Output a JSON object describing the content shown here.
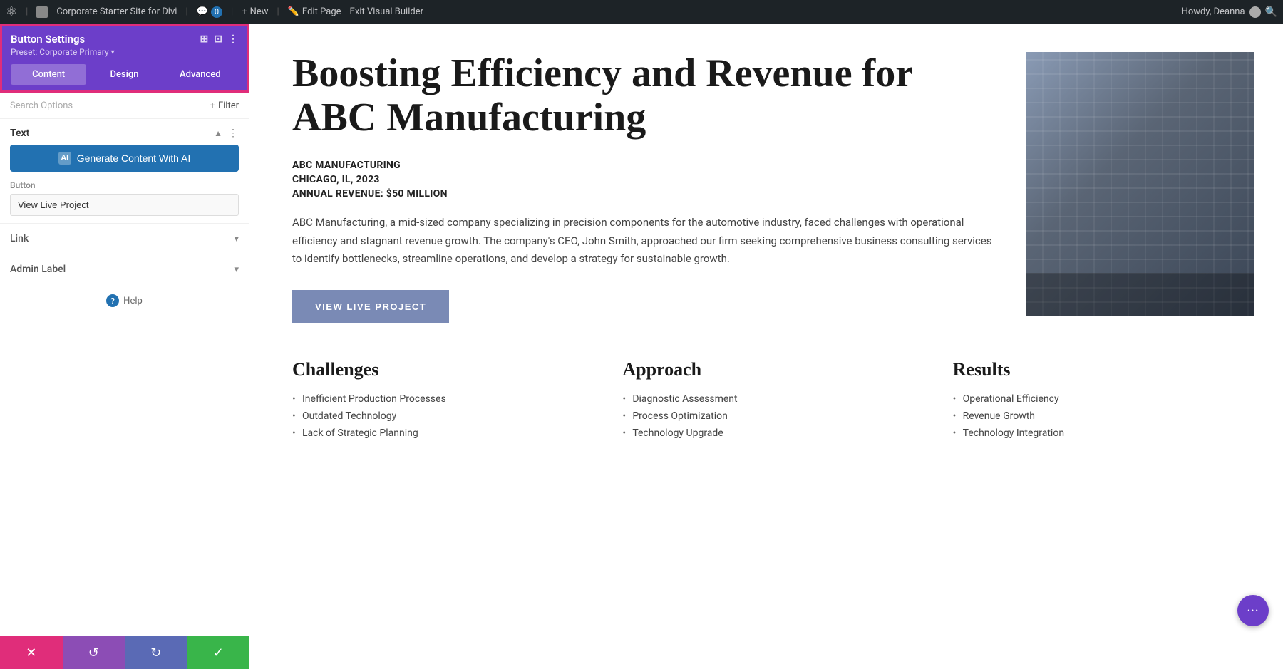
{
  "adminBar": {
    "wpLogo": "W",
    "siteName": "Corporate Starter Site for Divi",
    "commentsCount": "0",
    "newLabel": "New",
    "editPageLabel": "Edit Page",
    "exitLabel": "Exit Visual Builder",
    "howdyLabel": "Howdy, Deanna"
  },
  "sidebar": {
    "header": {
      "title": "Button Settings",
      "presetLabel": "Preset: Corporate Primary",
      "icons": [
        "⊞",
        "⊡",
        "⋮"
      ]
    },
    "tabs": [
      {
        "label": "Content",
        "active": true
      },
      {
        "label": "Design",
        "active": false
      },
      {
        "label": "Advanced",
        "active": false
      }
    ],
    "searchPlaceholder": "Search Options",
    "filterLabel": "Filter",
    "sections": {
      "text": {
        "title": "Text",
        "aiButtonLabel": "Generate Content With AI",
        "aiIcon": "AI"
      },
      "button": {
        "label": "Button",
        "value": "View Live Project"
      },
      "link": {
        "label": "Link"
      },
      "adminLabel": {
        "label": "Admin Label"
      }
    },
    "helpLabel": "Help"
  },
  "bottomToolbar": {
    "cancelIcon": "✕",
    "undoIcon": "↺",
    "redoIcon": "↻",
    "saveIcon": "✓"
  },
  "main": {
    "hero": {
      "title": "Boosting Efficiency and Revenue for ABC Manufacturing",
      "meta": {
        "company": "ABC MANUFACTURING",
        "location": "CHICAGO, IL, 2023",
        "revenue": "ANNUAL REVENUE: $50 MILLION"
      },
      "body": "ABC Manufacturing, a mid-sized company specializing in precision components for the automotive industry, faced challenges with operational efficiency and stagnant revenue growth. The company's CEO, John Smith, approached our firm seeking comprehensive business consulting services to identify bottlenecks, streamline operations, and develop a strategy for sustainable growth.",
      "buttonLabel": "VIEW LIVE PROJECT"
    },
    "columns": [
      {
        "title": "Challenges",
        "items": [
          "Inefficient Production Processes",
          "Outdated Technology",
          "Lack of Strategic Planning"
        ]
      },
      {
        "title": "Approach",
        "items": [
          "Diagnostic Assessment",
          "Process Optimization",
          "Technology Upgrade"
        ]
      },
      {
        "title": "Results",
        "items": [
          "Operational Efficiency",
          "Revenue Growth",
          "Technology Integration"
        ]
      }
    ]
  },
  "floatingBtn": "···"
}
